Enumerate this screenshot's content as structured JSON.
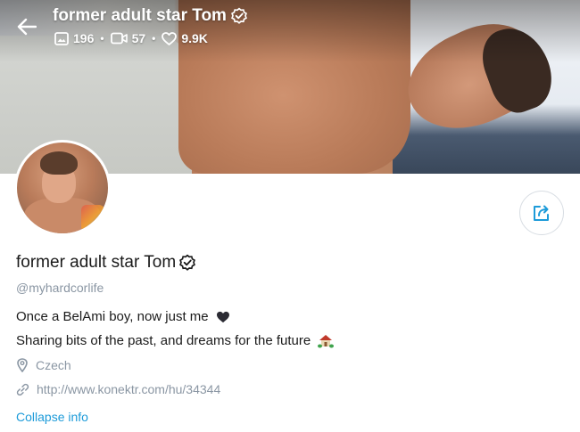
{
  "header": {
    "title": "former adult star Tom",
    "stats": [
      {
        "icon": "image-icon",
        "value": "196"
      },
      {
        "icon": "video-icon",
        "value": "57"
      },
      {
        "icon": "heart-icon",
        "value": "9.9K"
      }
    ]
  },
  "profile": {
    "name": "former adult star Tom",
    "handle": "@myhardcorlife",
    "bio_line1": "Once a BelAmi boy, now just me",
    "bio_line1_emoji": "black-heart-icon",
    "bio_line2": "Sharing bits of the past, and dreams for the future",
    "bio_line2_emoji": "house-with-garden-icon",
    "location": "Czech",
    "website": "http://www.konektr.com/hu/34344",
    "collapse_label": "Collapse info"
  },
  "colors": {
    "accent": "#1d9bd9",
    "muted": "#8a96a3",
    "text": "#1a1a1a"
  }
}
